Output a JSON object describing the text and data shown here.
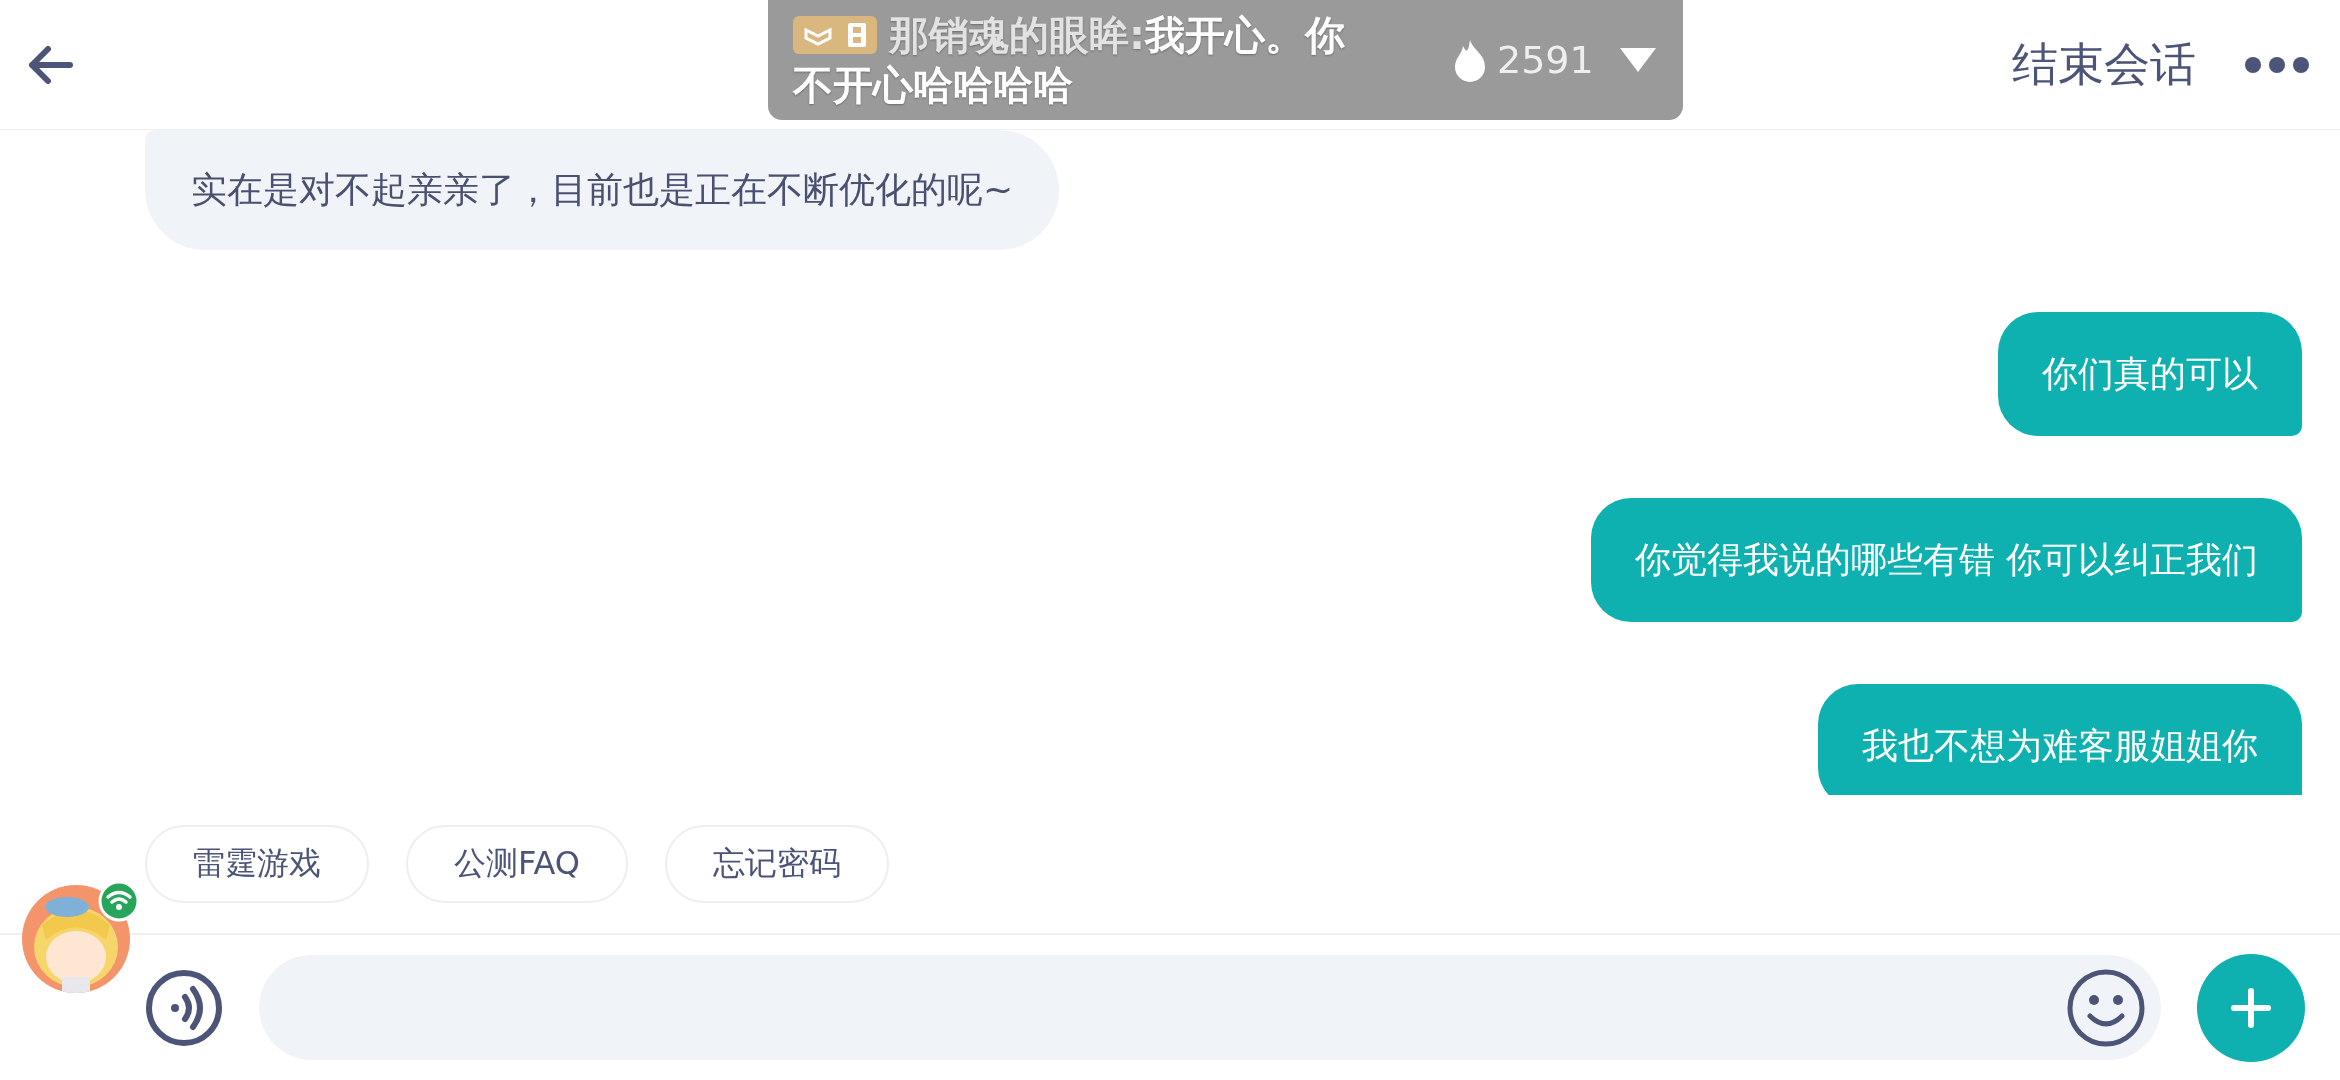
{
  "header": {
    "end_button": "结束会话"
  },
  "live_banner": {
    "sender": "那销魂的眼眸:",
    "text_lines": [
      "我开心。你",
      "不开心哈哈哈哈"
    ],
    "count": "2591"
  },
  "messages": [
    {
      "kind": "received",
      "text": "实在是对不起亲亲了，目前也是正在不断优化的呢~"
    },
    {
      "kind": "sent",
      "text": "你们真的可以"
    },
    {
      "kind": "sent",
      "text": "你觉得我说的哪些有错 你可以纠正我们"
    },
    {
      "kind": "sent",
      "text": "我也不想为难客服姐姐你"
    }
  ],
  "quick_replies": [
    "雷霆游戏",
    "公测FAQ",
    "忘记密码"
  ]
}
